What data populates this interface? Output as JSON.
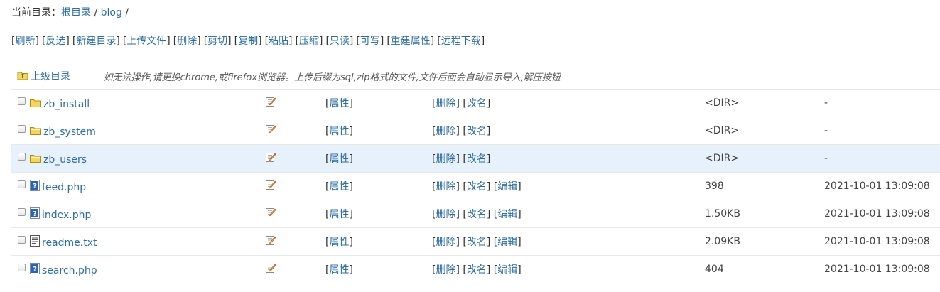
{
  "breadcrumb": {
    "prefix": "当前目录：",
    "root": "根目录",
    "sep1": " / ",
    "current": "blog",
    "sep2": " /"
  },
  "toolbar": [
    "刷新",
    "反选",
    "新建目录",
    "上传文件",
    "删除",
    "剪切",
    "复制",
    "粘贴",
    "压缩",
    "只读",
    "可写",
    "重建属性",
    "远程下载"
  ],
  "up_row": {
    "label": "上级目录",
    "notice": "如无法操作,请更换chrome,或firefox浏览器。上传后缀为sql,zip格式的文件,文件后面会自动显示导入,解压按钮"
  },
  "labels": {
    "attr": "属性",
    "delete": "删除",
    "rename": "改名",
    "edit": "编辑"
  },
  "files": [
    {
      "name": "zb_install",
      "type": "folder",
      "size": "<DIR>",
      "mtime": "-",
      "editable": false
    },
    {
      "name": "zb_system",
      "type": "folder",
      "size": "<DIR>",
      "mtime": "-",
      "editable": false
    },
    {
      "name": "zb_users",
      "type": "folder",
      "size": "<DIR>",
      "mtime": "-",
      "editable": false,
      "highlighted": true
    },
    {
      "name": "feed.php",
      "type": "php",
      "size": "398",
      "mtime": "2021-10-01 13:09:08",
      "editable": true
    },
    {
      "name": "index.php",
      "type": "php",
      "size": "1.50KB",
      "mtime": "2021-10-01 13:09:08",
      "editable": true
    },
    {
      "name": "readme.txt",
      "type": "txt",
      "size": "2.09KB",
      "mtime": "2021-10-01 13:09:08",
      "editable": true
    },
    {
      "name": "search.php",
      "type": "php",
      "size": "404",
      "mtime": "2021-10-01 13:09:08",
      "editable": true
    }
  ],
  "colors": {
    "link": "#2e6da4",
    "highlight": "#e7f1fb",
    "folder": "#f7d55c",
    "php_icon": "#2b63b8"
  }
}
